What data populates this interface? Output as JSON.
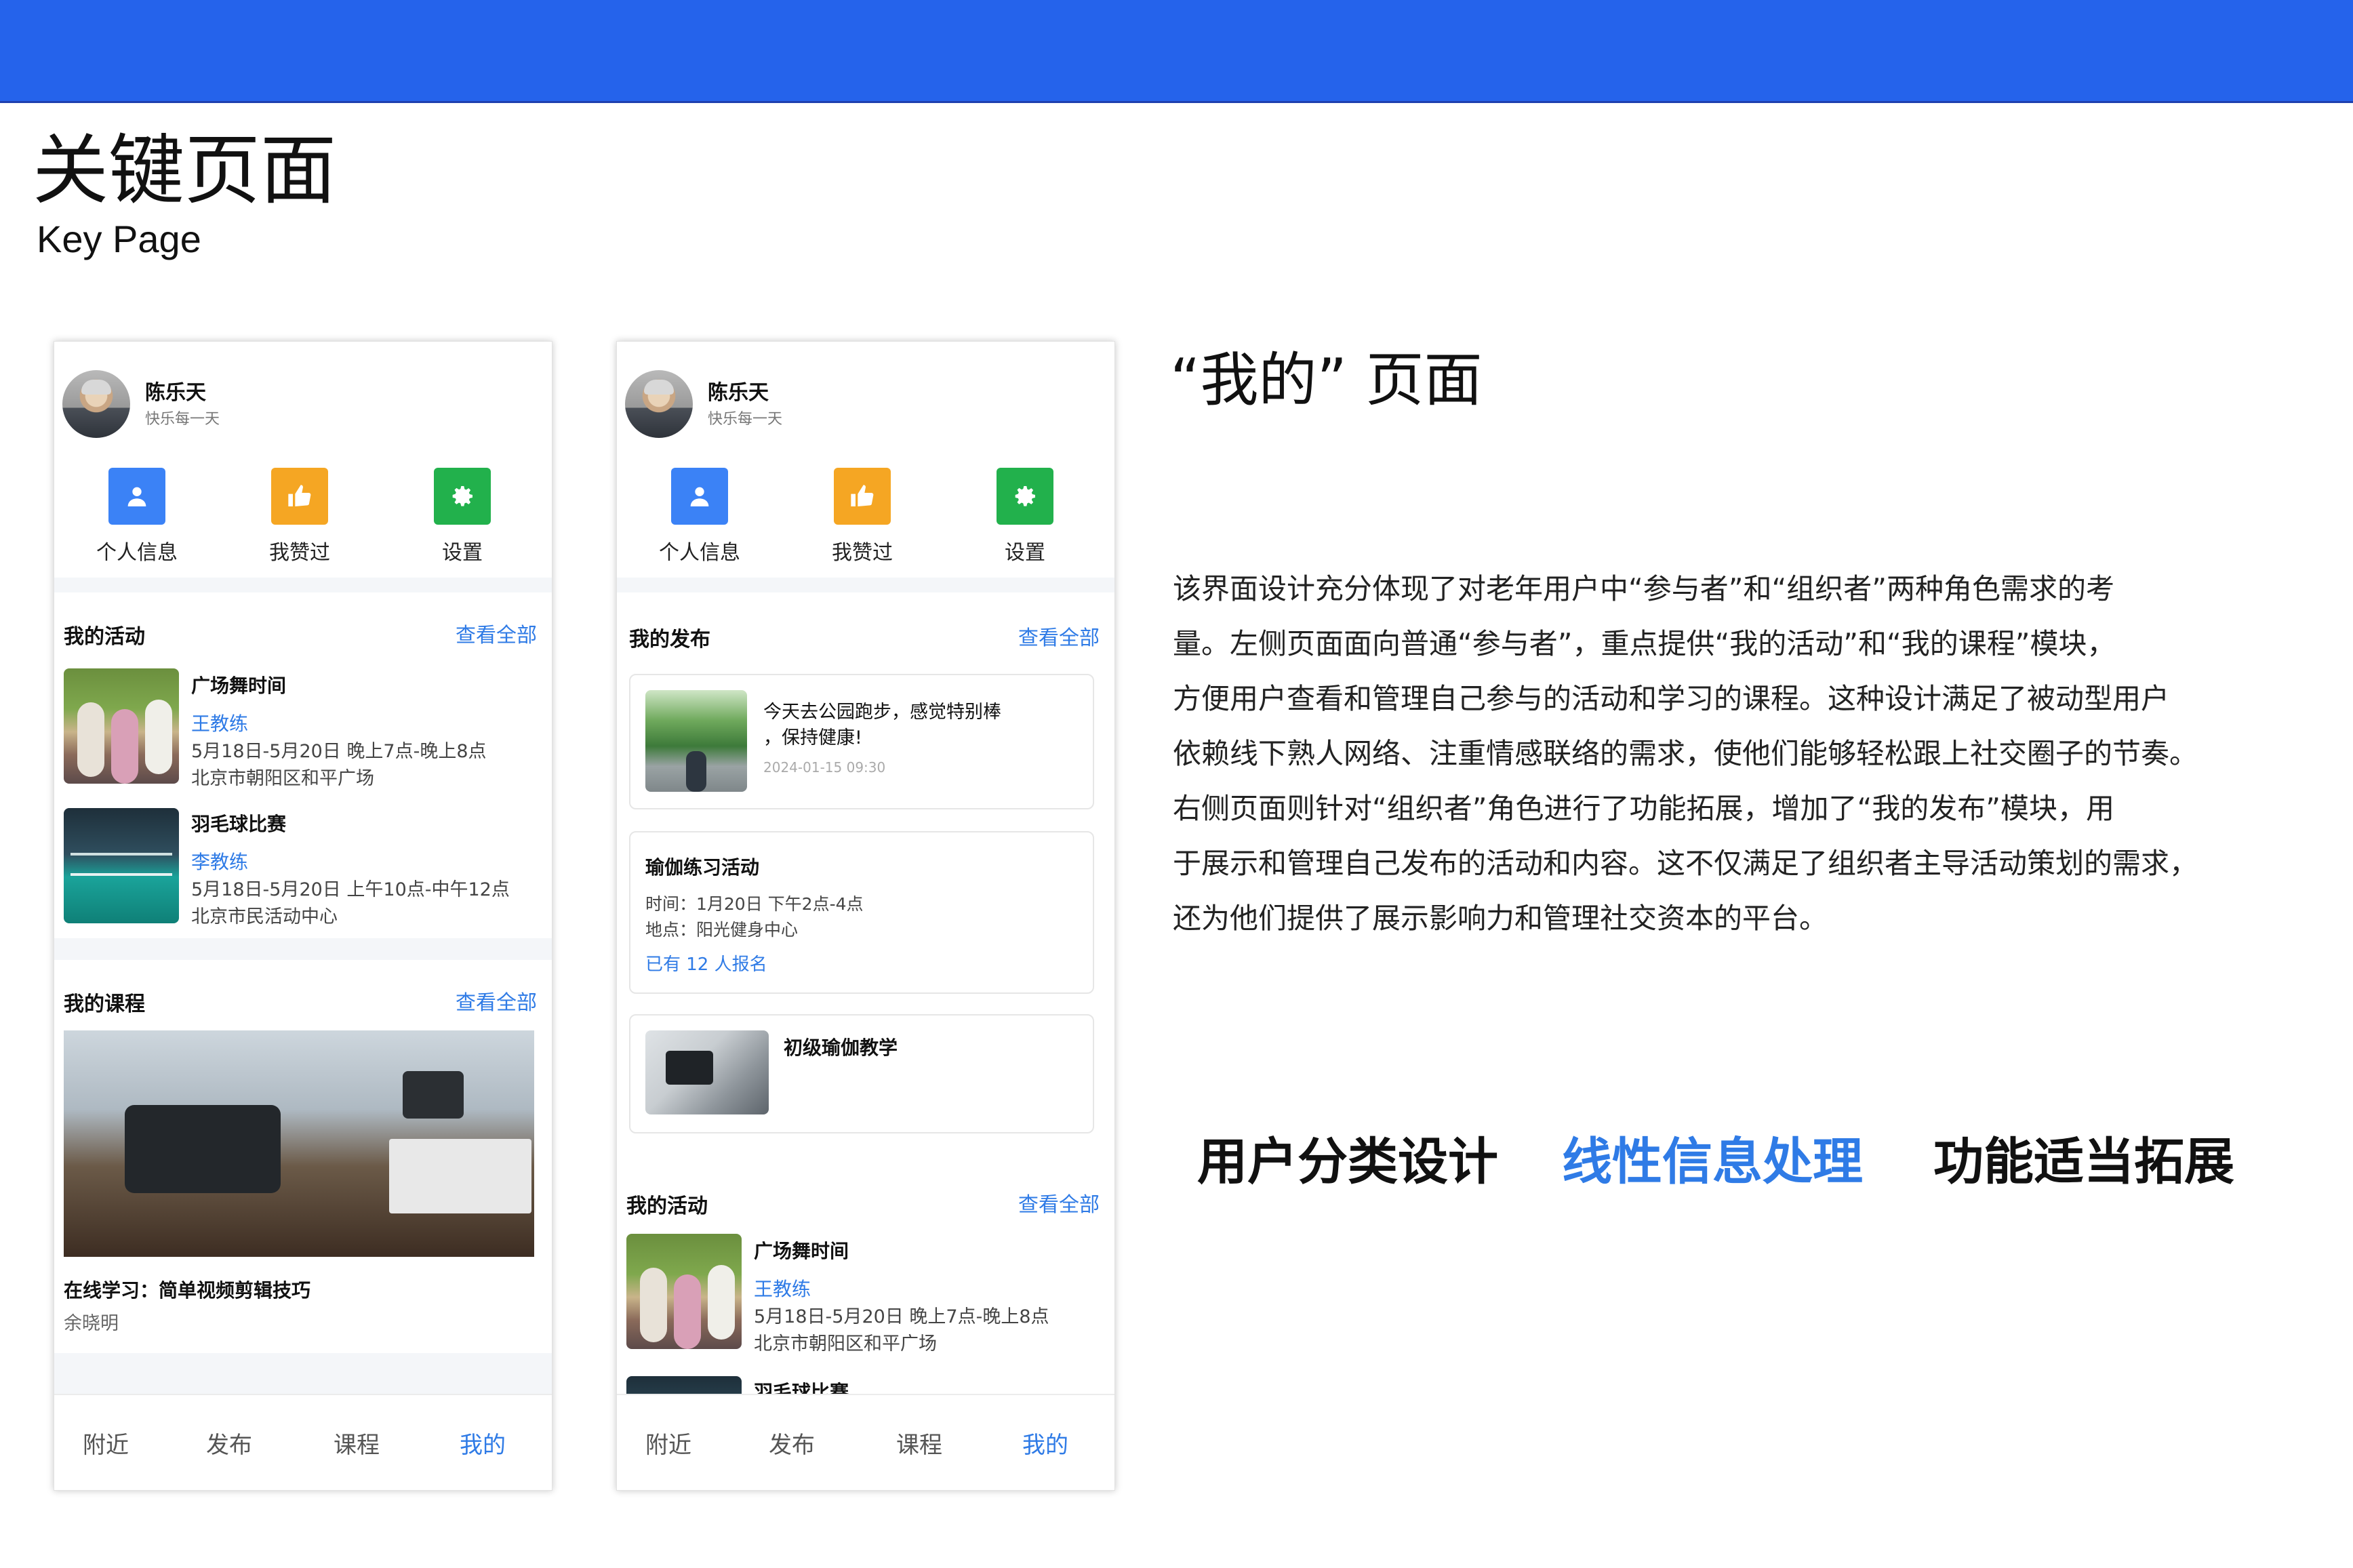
{
  "page": {
    "title": "关键页面",
    "subtitle": "Key Page"
  },
  "user": {
    "name": "陈乐天",
    "motto": "快乐每一天"
  },
  "quick_actions": [
    {
      "label": "个人信息",
      "icon": "user-icon",
      "color": "#3b82f6"
    },
    {
      "label": "我赞过",
      "icon": "thumbs-up-icon",
      "color": "#f5a623"
    },
    {
      "label": "设置",
      "icon": "gear-icon",
      "color": "#22b14c"
    }
  ],
  "view_all": "查看全部",
  "activities": {
    "title": "我的活动",
    "items": [
      {
        "name": "广场舞时间",
        "coach": "王教练",
        "time": "5月18日-5月20日 晚上7点-晚上8点",
        "place": "北京市朝阳区和平广场"
      },
      {
        "name": "羽毛球比赛",
        "coach": "李教练",
        "time": "5月18日-5月20日 上午10点-中午12点",
        "place": "北京市民活动中心"
      }
    ]
  },
  "courses": {
    "title": "我的课程",
    "course_name": "在线学习：简单视频剪辑技巧",
    "teacher": "余晓明"
  },
  "posts": {
    "title": "我的发布",
    "post1": {
      "text_line1": "今天去公园跑步，感觉特别棒",
      "text_line2": "，保持健康!",
      "time": "2024-01-15 09:30"
    },
    "post2": {
      "title": "瑜伽练习活动",
      "time": "时间：1月20日 下午2点-4点",
      "place": "地点：阳光健身中心",
      "signup": "已有 12 人报名"
    },
    "post3": {
      "title": "初级瑜伽教学"
    }
  },
  "tabbar": {
    "items": [
      "附近",
      "发布",
      "课程",
      "我的"
    ],
    "active_color": "#2f7be6"
  },
  "right": {
    "heading": "“我的” 页面",
    "paragraph": [
      "该界面设计充分体现了对老年用户中“参与者”和“组织者”两种角色需求的考",
      "量。左侧页面面向普通“参与者”，重点提供“我的活动”和“我的课程”模块，",
      "方便用户查看和管理自己参与的活动和学习的课程。这种设计满足了被动型用户",
      "依赖线下熟人网络、注重情感联络的需求，使他们能够轻松跟上社交圈子的节奏。",
      "右侧页面则针对“组织者”角色进行了功能拓展，增加了“我的发布”模块，用",
      "于展示和管理自己发布的活动和内容。这不仅满足了组织者主导活动策划的需求，",
      "还为他们提供了展示影响力和管理社交资本的平台。"
    ],
    "features": [
      "用户分类设计",
      "线性信息处理",
      "功能适当拓展"
    ]
  },
  "colors": {
    "brand_blue": "#2563eb",
    "link_blue": "#2f7be6"
  }
}
